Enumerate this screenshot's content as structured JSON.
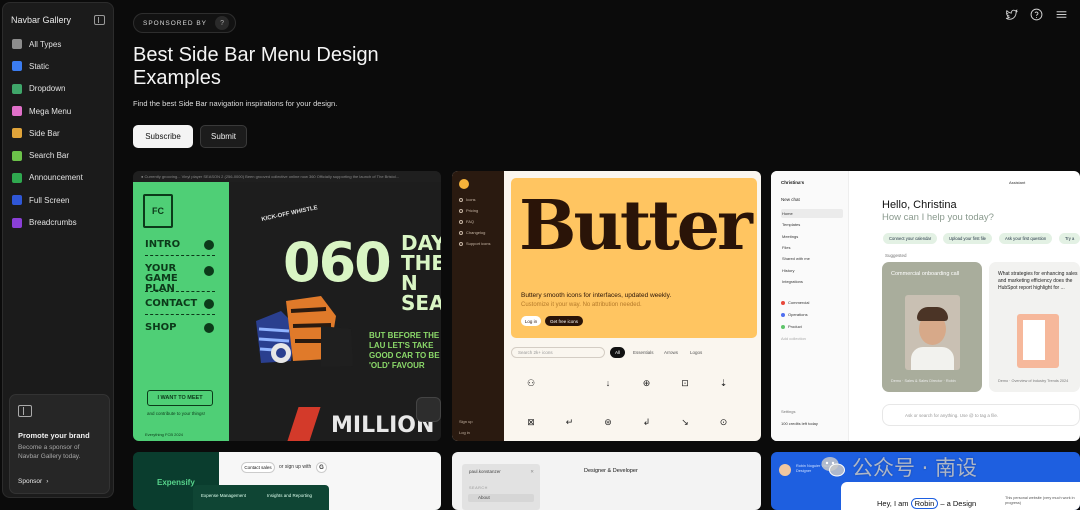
{
  "sidebar": {
    "title": "Navbar Gallery",
    "items": [
      {
        "label": "All Types",
        "icon": "grid-icon",
        "color": "#8d8d8d"
      },
      {
        "label": "Static",
        "icon": "static-icon",
        "color": "#3b7cf0"
      },
      {
        "label": "Dropdown",
        "icon": "dropdown-icon",
        "color": "#3fa66a"
      },
      {
        "label": "Mega Menu",
        "icon": "mega-menu-icon",
        "color": "#e070c9"
      },
      {
        "label": "Side Bar",
        "icon": "side-bar-icon",
        "color": "#e0a43a"
      },
      {
        "label": "Search Bar",
        "icon": "search-bar-icon",
        "color": "#6cc24a"
      },
      {
        "label": "Announcement",
        "icon": "megaphone-icon",
        "color": "#2fa84f"
      },
      {
        "label": "Full Screen",
        "icon": "full-screen-icon",
        "color": "#2f56d6"
      },
      {
        "label": "Breadcrumbs",
        "icon": "breadcrumbs-icon",
        "color": "#8a3fd6"
      }
    ],
    "promo": {
      "title": "Promote your brand",
      "text": "Become a sponsor of Navbar Gallery today.",
      "link": "Sponsor"
    }
  },
  "hero": {
    "sponsored_label": "SPONSORED BY",
    "sponsored_help": "?",
    "title": "Best Side Bar Menu Design Examples",
    "subtitle": "Find the best Side Bar navigation inspirations for your design.",
    "subscribe_label": "Subscribe",
    "submit_label": "Submit"
  },
  "cards": {
    "sports": {
      "topbar": "● Currently grooving...   Vinyl player    SEASON 2 (256-0000)    Been grooved collective online now    360    Officially supporting the launch of The Bristol...",
      "nav": [
        "INTRO",
        "YOUR GAME PLAN",
        "CONTACT",
        "SHOP"
      ],
      "meet": "I WANT TO MEET",
      "contribute": "and contribute to your things!",
      "footer": "Everything FCB 2024",
      "big": "060",
      "days": "DAYS THE N SEAS",
      "launch": "BUT BEFORE THE LAU LET'S TAKE GOOD CAR TO BE 'OLD' FAVOUR",
      "million": "MILLION PIE",
      "kickoff": "KICK-OFF WHISTLE"
    },
    "butter": {
      "nav": [
        "Icons",
        "Pricing",
        "FAQ",
        "Changelog",
        "Support icons"
      ],
      "nav_bottom": [
        "Sign up",
        "Log in"
      ],
      "word": "Butter",
      "tagline": "Buttery smooth icons for interfaces, updated weekly.",
      "tagline2": "Customize it your way. No attribution needed.",
      "login": "Log in",
      "free": "Get free icons",
      "search": "Search 2k+ icons",
      "chips": [
        "All",
        "Essentials",
        "Arrows",
        "Logos"
      ],
      "icons": [
        "⚇",
        "",
        "↓",
        "⊕",
        "⊡",
        "⇣",
        "⊠",
        "↵",
        "⊛",
        "↲",
        "↘",
        "⊙"
      ]
    },
    "assistant": {
      "brand": "Christina's",
      "new_chat": "New chat",
      "items": [
        "Home",
        "Templates",
        "Meetings",
        "Files",
        "Shared with me",
        "History",
        "Integrations"
      ],
      "tags": [
        {
          "label": "Commercial",
          "color": "#e8483b"
        },
        {
          "label": "Operations",
          "color": "#4f6ef0"
        },
        {
          "label": "Product",
          "color": "#5ec46a"
        }
      ],
      "add_collection": "Add collection",
      "settings": "Settings",
      "credits": "100 credits left today",
      "assistant_label": "Assistant",
      "hello": "Hello, Christina",
      "help": "How can I help you today?",
      "pills": [
        "Connect your calendar",
        "Upload your first file",
        "Ask your first question",
        "Try a"
      ],
      "suggested": "Suggested",
      "card1_title": "Commercial onboarding call",
      "card1_caption": "Demo · Sales & Sales Director · Robin",
      "card2_title": "What strategies for enhancing sales and marketing efficiency does the HubSpot report highlight for ...",
      "card2_caption": "Demo · Overview of Industry Trends 2024",
      "input": "Ask or search for anything. Use @ to tag a file."
    },
    "expensify": {
      "logo": "Expensify",
      "contact": "Contact sales",
      "signup": "or sign up with",
      "g": "G",
      "menu": [
        "Expense Management",
        "Insights and Reporting"
      ]
    },
    "portfolio": {
      "panel_title": "paul.konstanzer",
      "close": "✕",
      "search": "SEARCH",
      "about": "About",
      "title": "Designer & Developer"
    },
    "robin": {
      "brand": "Robin Noguier Visual Designer",
      "hey": "Hey, I am",
      "name": "Robin",
      "rest": "– a Design",
      "small": "This personal website (very much work in progress)"
    }
  },
  "watermark": "公众号 · 南设"
}
